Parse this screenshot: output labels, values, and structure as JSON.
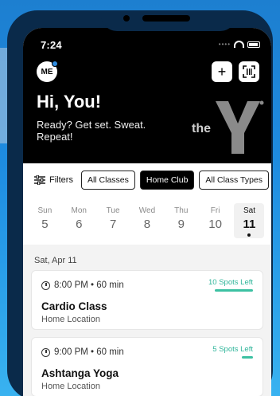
{
  "status": {
    "time": "7:24"
  },
  "header": {
    "avatar_initials": "ME",
    "greeting": "Hi, You!",
    "subtitle": "Ready? Get set. Sweat. Repeat!",
    "logo_text": "the"
  },
  "filters": {
    "filters_label": "Filters",
    "chips": [
      {
        "label": "All Classes",
        "active": false
      },
      {
        "label": "Home Club",
        "active": true
      },
      {
        "label": "All Class Types",
        "active": false
      }
    ]
  },
  "days": [
    {
      "dow": "Sun",
      "num": "5"
    },
    {
      "dow": "Mon",
      "num": "6"
    },
    {
      "dow": "Tue",
      "num": "7"
    },
    {
      "dow": "Wed",
      "num": "8"
    },
    {
      "dow": "Thu",
      "num": "9"
    },
    {
      "dow": "Fri",
      "num": "10"
    },
    {
      "dow": "Sat",
      "num": "11",
      "selected": true
    }
  ],
  "list": {
    "date_header": "Sat, Apr 11",
    "classes": [
      {
        "time": "8:00 PM • 60 min",
        "name": "Cardio Class",
        "location": "Home Location",
        "spots": "10 Spots Left",
        "spots_color": "#2fb59a"
      },
      {
        "time": "9:00 PM • 60 min",
        "name": "Ashtanga Yoga",
        "location": "Home Location",
        "spots": "5 Spots Left",
        "spots_color": "#2fb59a"
      }
    ]
  },
  "icons": [
    "plus-icon",
    "qr-scan-icon",
    "filters-icon",
    "clock-icon",
    "wifi-icon",
    "battery-icon"
  ]
}
